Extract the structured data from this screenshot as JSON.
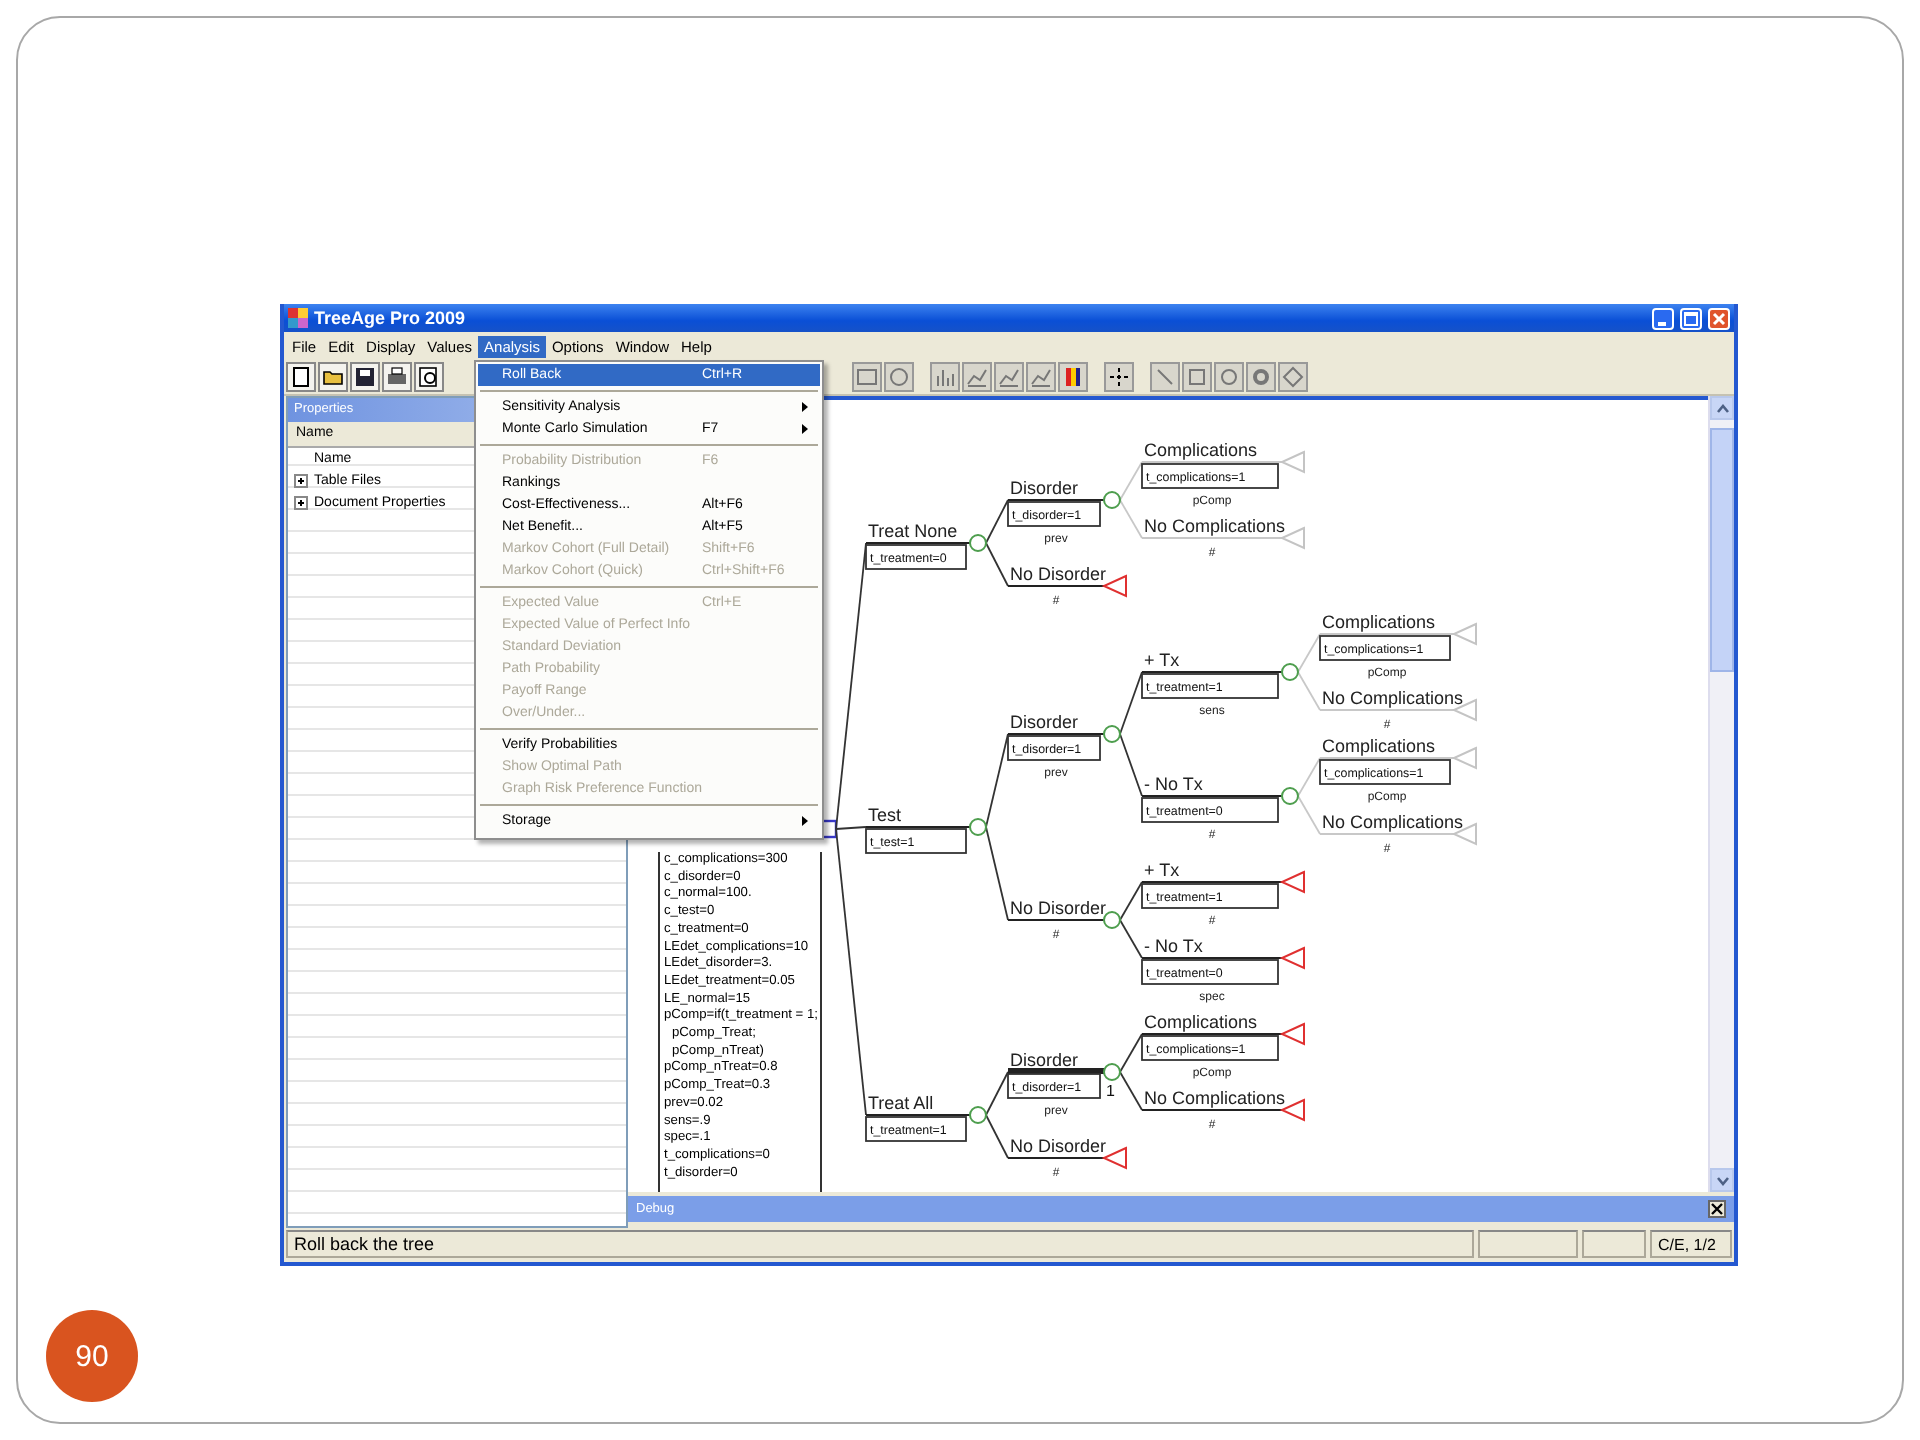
{
  "window": {
    "title": "TreeAge Pro 2009"
  },
  "menu_bar": [
    {
      "label": "File",
      "selected": false
    },
    {
      "label": "Edit",
      "selected": false
    },
    {
      "label": "Display",
      "selected": false
    },
    {
      "label": "Values",
      "selected": false
    },
    {
      "label": "Analysis",
      "selected": true
    },
    {
      "label": "Options",
      "selected": false
    },
    {
      "label": "Window",
      "selected": false
    },
    {
      "label": "Help",
      "selected": false
    }
  ],
  "analysis_menu": {
    "groups": [
      [
        {
          "label": "Roll Back",
          "shortcut": "Ctrl+R",
          "selected": true,
          "disabled": false,
          "submenu": false
        }
      ],
      [
        {
          "label": "Sensitivity Analysis",
          "selected": false,
          "disabled": false,
          "submenu": true
        },
        {
          "label": "Monte Carlo Simulation",
          "shortcut": "F7",
          "selected": false,
          "disabled": false,
          "submenu": true
        }
      ],
      [
        {
          "label": "Probability Distribution",
          "shortcut": "F6",
          "selected": false,
          "disabled": true,
          "submenu": false
        },
        {
          "label": "Rankings",
          "selected": false,
          "disabled": false,
          "submenu": false
        },
        {
          "label": "Cost-Effectiveness...",
          "shortcut": "Alt+F6",
          "selected": false,
          "disabled": false,
          "submenu": false
        },
        {
          "label": "Net Benefit...",
          "shortcut": "Alt+F5",
          "selected": false,
          "disabled": false,
          "submenu": false
        },
        {
          "label": "Markov Cohort (Full Detail)",
          "shortcut": "Shift+F6",
          "selected": false,
          "disabled": true,
          "submenu": false
        },
        {
          "label": "Markov Cohort (Quick)",
          "shortcut": "Ctrl+Shift+F6",
          "selected": false,
          "disabled": true,
          "submenu": false
        }
      ],
      [
        {
          "label": "Expected Value",
          "shortcut": "Ctrl+E",
          "selected": false,
          "disabled": true,
          "submenu": false
        },
        {
          "label": "Expected Value of Perfect Info",
          "selected": false,
          "disabled": true,
          "submenu": false
        },
        {
          "label": "Standard Deviation",
          "selected": false,
          "disabled": true,
          "submenu": false
        },
        {
          "label": "Path Probability",
          "selected": false,
          "disabled": true,
          "submenu": false
        },
        {
          "label": "Payoff Range",
          "selected": false,
          "disabled": true,
          "submenu": false
        },
        {
          "label": "Over/Under...",
          "selected": false,
          "disabled": true,
          "submenu": false
        }
      ],
      [
        {
          "label": "Verify Probabilities",
          "selected": false,
          "disabled": false,
          "submenu": false
        },
        {
          "label": "Show Optimal Path",
          "selected": false,
          "disabled": true,
          "submenu": false
        },
        {
          "label": "Graph Risk Preference Function",
          "selected": false,
          "disabled": true,
          "submenu": false
        }
      ],
      [
        {
          "label": "Storage",
          "selected": false,
          "disabled": false,
          "submenu": true
        }
      ]
    ]
  },
  "properties_panel": {
    "title": "Properties",
    "column": "Name",
    "rows": [
      {
        "label": "Name",
        "expandable": false
      },
      {
        "label": "Table Files",
        "expandable": true
      },
      {
        "label": "Document Properties",
        "expandable": true
      }
    ]
  },
  "variables": [
    "c_complications=300",
    "c_disorder=0",
    "c_normal=100.",
    "c_test=0",
    "c_treatment=0",
    "LEdet_complications=10",
    "LEdet_disorder=3.",
    "LEdet_treatment=0.05",
    "LE_normal=15",
    "pComp=if(t_treatment = 1; pComp_Treat; pComp_nTreat)",
    "pComp_nTreat=0.8",
    "pComp_Treat=0.3",
    "prev=0.02",
    "sens=.9",
    "spec=.1",
    "t_complications=0",
    "t_disorder=0"
  ],
  "tree": {
    "root": {
      "kind": "decision"
    },
    "branches": [
      {
        "label": "Treat None",
        "definition": "t_treatment=0",
        "kind": "chance",
        "dimmed": false,
        "highlighted": false,
        "children": [
          {
            "label": "Disorder",
            "definition": "t_disorder=1",
            "probability": "prev",
            "kind": "chance",
            "dimmed": false,
            "highlighted": false,
            "children": [
              {
                "label": "Complications",
                "definition": "t_complications=1",
                "probability": "pComp",
                "kind": "terminal",
                "dimmed": true,
                "highlighted": false
              },
              {
                "label": "No Complications",
                "probability": "#",
                "kind": "terminal",
                "dimmed": true,
                "highlighted": false
              }
            ]
          },
          {
            "label": "No Disorder",
            "probability": "#",
            "kind": "terminal",
            "dimmed": false,
            "highlighted": false
          }
        ]
      },
      {
        "label": "Test",
        "definition": "t_test=1",
        "kind": "chance",
        "dimmed": false,
        "highlighted": false,
        "children": [
          {
            "label": "Disorder",
            "definition": "t_disorder=1",
            "probability": "prev",
            "kind": "chance",
            "dimmed": false,
            "highlighted": false,
            "children": [
              {
                "label": "+ Tx",
                "definition": "t_treatment=1",
                "probability": "sens",
                "kind": "chance",
                "dimmed": false,
                "highlighted": false,
                "children": [
                  {
                    "label": "Complications",
                    "definition": "t_complications=1",
                    "probability": "pComp",
                    "kind": "terminal",
                    "dimmed": true,
                    "highlighted": false
                  },
                  {
                    "label": "No Complications",
                    "probability": "#",
                    "kind": "terminal",
                    "dimmed": true,
                    "highlighted": false
                  }
                ]
              },
              {
                "label": "- No Tx",
                "definition": "t_treatment=0",
                "probability": "#",
                "kind": "chance",
                "dimmed": false,
                "highlighted": false,
                "children": [
                  {
                    "label": "Complications",
                    "definition": "t_complications=1",
                    "probability": "pComp",
                    "kind": "terminal",
                    "dimmed": true,
                    "highlighted": false
                  },
                  {
                    "label": "No Complications",
                    "probability": "#",
                    "kind": "terminal",
                    "dimmed": true,
                    "highlighted": false
                  }
                ]
              }
            ]
          },
          {
            "label": "No Disorder",
            "probability": "#",
            "kind": "chance",
            "dimmed": false,
            "highlighted": false,
            "children": [
              {
                "label": "+ Tx",
                "definition": "t_treatment=1",
                "probability": "#",
                "kind": "terminal",
                "dimmed": false,
                "highlighted": false
              },
              {
                "label": "- No Tx",
                "definition": "t_treatment=0",
                "probability": "spec",
                "kind": "terminal",
                "dimmed": false,
                "highlighted": false
              }
            ]
          }
        ]
      },
      {
        "label": "Treat All",
        "definition": "t_treatment=1",
        "kind": "chance",
        "dimmed": false,
        "highlighted": false,
        "children": [
          {
            "label": "Disorder",
            "definition": "t_disorder=1",
            "probability": "prev",
            "note": "1",
            "kind": "chance",
            "dimmed": false,
            "highlighted": true,
            "children": [
              {
                "label": "Complications",
                "definition": "t_complications=1",
                "probability": "pComp",
                "kind": "terminal",
                "dimmed": false,
                "highlighted": false
              },
              {
                "label": "No Complications",
                "probability": "#",
                "kind": "terminal",
                "dimmed": false,
                "highlighted": false
              }
            ]
          },
          {
            "label": "No Disorder",
            "probability": "#",
            "kind": "terminal",
            "dimmed": false,
            "highlighted": false
          }
        ]
      }
    ]
  },
  "debug_panel": {
    "title": "Debug"
  },
  "status_bar": {
    "text": "Roll back the tree",
    "mode": "C/E, 1/2"
  },
  "slide_number": "90"
}
